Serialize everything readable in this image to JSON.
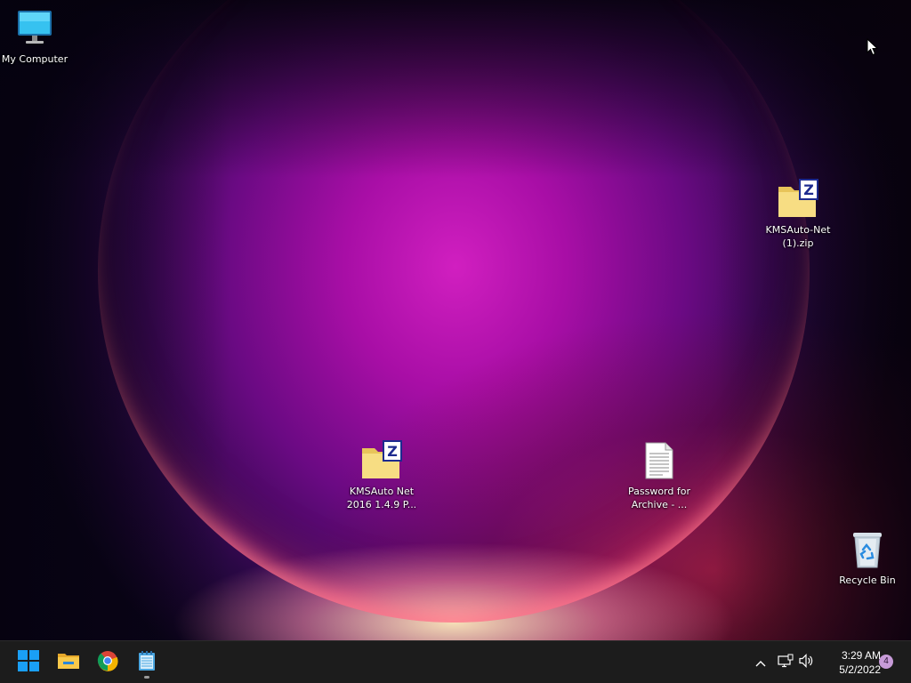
{
  "desktop": {
    "icons": {
      "my_computer": {
        "label": "My Computer"
      },
      "kms_zip_1": {
        "label": "KMSAuto-Net (1).zip"
      },
      "kms_zip_2016": {
        "label": "KMSAuto Net 2016 1.4.9 P..."
      },
      "password_txt": {
        "label": "Password for Archive - ..."
      },
      "recycle_bin": {
        "label": "Recycle Bin"
      }
    }
  },
  "taskbar": {
    "apps": [
      {
        "name": "start",
        "icon": "windows-logo-icon"
      },
      {
        "name": "file-explorer",
        "icon": "folder-icon"
      },
      {
        "name": "chrome",
        "icon": "chrome-icon"
      },
      {
        "name": "notepad",
        "icon": "notepad-icon",
        "running": true
      }
    ],
    "tray": {
      "chevron": "chevron-up-icon",
      "network": "network-icon",
      "volume": "volume-icon"
    },
    "clock": {
      "time": "3:29 AM",
      "date": "5/2/2022"
    },
    "notifications": {
      "count": "4"
    }
  },
  "colors": {
    "taskbar_bg": "#1c1c1c",
    "accent_start": "#1a9ff5",
    "notification_badge": "#c79bd8"
  }
}
